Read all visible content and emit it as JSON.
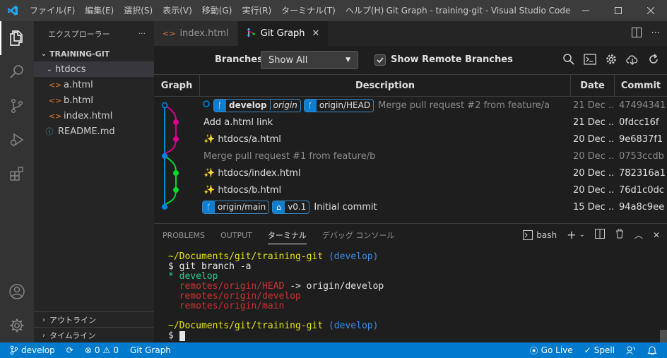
{
  "titlebar": {
    "menu": [
      "ファイル(F)",
      "編集(E)",
      "選択(S)",
      "表示(V)",
      "移動(G)",
      "実行(R)",
      "ターミナル(T)",
      "ヘルプ(H)"
    ],
    "title": "Git Graph - training-git - Visual Studio Code"
  },
  "sidebar": {
    "header": "エクスプローラー",
    "more": "···",
    "section": "TRAINING-GIT",
    "tree": [
      {
        "label": "htdocs",
        "type": "folder"
      },
      {
        "label": "a.html",
        "type": "html"
      },
      {
        "label": "b.html",
        "type": "html"
      },
      {
        "label": "index.html",
        "type": "html"
      },
      {
        "label": "README.md",
        "type": "info"
      }
    ],
    "outline": "アウトライン",
    "timeline": "タイムライン"
  },
  "tabs": [
    {
      "label": "index.html",
      "icon": "html-icon",
      "active": false
    },
    {
      "label": "Git Graph",
      "icon": "git-graph-icon",
      "active": true
    }
  ],
  "gitgraph": {
    "branches_label": "Branches:",
    "branches_value": "Show All",
    "show_remote_label": "Show Remote Branches",
    "show_remote_checked": true,
    "columns": [
      "Graph",
      "Description",
      "Date",
      "Commit"
    ],
    "rows": [
      {
        "refs": [
          {
            "name": "develop",
            "remote": "origin",
            "head": true
          },
          {
            "name": "origin/HEAD"
          }
        ],
        "message": "Merge pull request #2 from feature/a",
        "date": "21 Dec ...",
        "commit": "47494341",
        "muted": true
      },
      {
        "refs": [],
        "message": "Add a.html link",
        "date": "21 Dec ...",
        "commit": "0fdcc16f",
        "muted": false
      },
      {
        "refs": [],
        "message": "✨ htdocs/a.html",
        "date": "20 Dec ...",
        "commit": "9e6837f1",
        "muted": false
      },
      {
        "refs": [],
        "message": "Merge pull request #1 from feature/b",
        "date": "20 Dec ...",
        "commit": "0753ccdb",
        "muted": true
      },
      {
        "refs": [],
        "message": "✨ htdocs/index.html",
        "date": "20 Dec ...",
        "commit": "782316a1",
        "muted": false
      },
      {
        "refs": [],
        "message": "✨ htdocs/b.html",
        "date": "20 Dec ...",
        "commit": "76d1c0dc",
        "muted": false
      },
      {
        "refs": [
          {
            "name": "origin/main"
          },
          {
            "name": "v0.1",
            "tag": true
          }
        ],
        "message": "Initial commit",
        "date": "15 Dec ...",
        "commit": "94a8c9ee",
        "muted": false
      }
    ],
    "graph_colors": {
      "main": "#0085d9",
      "pink": "#d9008f",
      "green": "#00d92b"
    }
  },
  "panel": {
    "tabs": [
      "PROBLEMS",
      "OUTPUT",
      "ターミナル",
      "デバッグ コンソール"
    ],
    "active_tab": "ターミナル",
    "shell": "bash",
    "terminal": {
      "prompt1_path": "~/Documents/git/training-git",
      "prompt1_branch": "(develop)",
      "cmd1": "$ git branch -a",
      "branch_current": "* develop",
      "remote_head": "remotes/origin/HEAD",
      "remote_head_arrow": " -> origin/develop",
      "remote_develop": "remotes/origin/develop",
      "remote_main": "remotes/origin/main",
      "prompt2_path": "~/Documents/git/training-git",
      "prompt2_branch": "(develop)",
      "cmd2": "$ "
    }
  },
  "statusbar": {
    "branch": "develop",
    "errors": "0",
    "warnings": "0",
    "gitgraph": "Git Graph",
    "golive": "Go Live",
    "spell": "Spell"
  }
}
